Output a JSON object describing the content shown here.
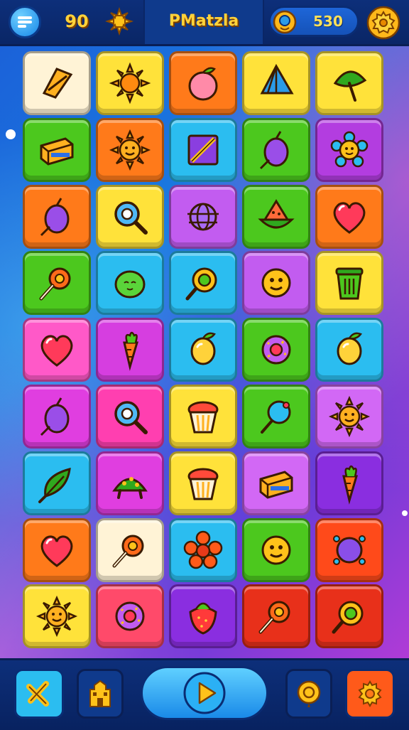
{
  "header": {
    "menu_icon": "menu-icon",
    "score": "90",
    "star_icon": "star-icon",
    "title": "PMatzla",
    "coin_icon": "coin-icon",
    "coins": "530",
    "settings_icon": "gear-icon"
  },
  "board": {
    "rows": 9,
    "cols": 5,
    "tiles": [
      {
        "color": "#fff3d6",
        "icon": "kite-icon"
      },
      {
        "color": "#ffe23a",
        "icon": "sun-icon"
      },
      {
        "color": "#ff7a1a",
        "icon": "peach-icon"
      },
      {
        "color": "#ffe23a",
        "icon": "prism-icon"
      },
      {
        "color": "#ffe23a",
        "icon": "leaf-icon"
      },
      {
        "color": "#4cc81e",
        "icon": "box-icon"
      },
      {
        "color": "#ff7a1a",
        "icon": "sun-face-icon"
      },
      {
        "color": "#2bbdf0",
        "icon": "square-knife-icon"
      },
      {
        "color": "#4cc81e",
        "icon": "plum-icon"
      },
      {
        "color": "#b33de0",
        "icon": "flower-face-icon"
      },
      {
        "color": "#ff7a1a",
        "icon": "plum-icon"
      },
      {
        "color": "#ffe23a",
        "icon": "magnifier-icon"
      },
      {
        "color": "#c25cf0",
        "icon": "globe-icon"
      },
      {
        "color": "#4cc81e",
        "icon": "watermelon-icon"
      },
      {
        "color": "#ff7a1a",
        "icon": "heart-icon"
      },
      {
        "color": "#4cc81e",
        "icon": "lollipop-icon"
      },
      {
        "color": "#2bbdf0",
        "icon": "cactus-icon"
      },
      {
        "color": "#2bbdf0",
        "icon": "ring-pop-icon"
      },
      {
        "color": "#c25cf0",
        "icon": "face-icon"
      },
      {
        "color": "#ffe23a",
        "icon": "cup-icon"
      },
      {
        "color": "#ff59c8",
        "icon": "heart-icon"
      },
      {
        "color": "#d63ee0",
        "icon": "carrot-icon"
      },
      {
        "color": "#2bbdf0",
        "icon": "lemon-icon"
      },
      {
        "color": "#4cc81e",
        "icon": "donut-icon"
      },
      {
        "color": "#2bbdf0",
        "icon": "lemon-icon"
      },
      {
        "color": "#e03ee0",
        "icon": "plum-icon"
      },
      {
        "color": "#ff3fb0",
        "icon": "magnifier-icon"
      },
      {
        "color": "#ffe23a",
        "icon": "cupcake-icon"
      },
      {
        "color": "#4cc81e",
        "icon": "balloon-icon"
      },
      {
        "color": "#d268f5",
        "icon": "sun-face-icon"
      },
      {
        "color": "#2bbdf0",
        "icon": "feather-icon"
      },
      {
        "color": "#e03ee0",
        "icon": "turtle-icon"
      },
      {
        "color": "#ffe23a",
        "icon": "cupcake-icon"
      },
      {
        "color": "#d268f5",
        "icon": "box-icon"
      },
      {
        "color": "#8a2ee0",
        "icon": "carrot-icon"
      },
      {
        "color": "#ff7a1a",
        "icon": "heart-icon"
      },
      {
        "color": "#fff3d6",
        "icon": "lollipop-icon"
      },
      {
        "color": "#2bbdf0",
        "icon": "flower-icon"
      },
      {
        "color": "#4cc81e",
        "icon": "face-icon"
      },
      {
        "color": "#ff4a1a",
        "icon": "planet-icon"
      },
      {
        "color": "#ffe23a",
        "icon": "sun-face-icon"
      },
      {
        "color": "#ff4a6a",
        "icon": "donut-icon"
      },
      {
        "color": "#8a2ee0",
        "icon": "strawberry-icon"
      },
      {
        "color": "#e8301a",
        "icon": "lollipop-icon"
      },
      {
        "color": "#e8301a",
        "icon": "ring-pop-icon"
      }
    ]
  },
  "footer": {
    "buttons": [
      {
        "icon": "cross-icon",
        "color": "#2bbdf0"
      },
      {
        "icon": "castle-icon",
        "color": "#0f3a8c"
      },
      {
        "icon": "play-icon",
        "color": "#2bbdf0"
      },
      {
        "icon": "coin-icon",
        "color": "#0f3a8c"
      },
      {
        "icon": "gear-icon",
        "color": "#ff5a1a"
      }
    ]
  }
}
